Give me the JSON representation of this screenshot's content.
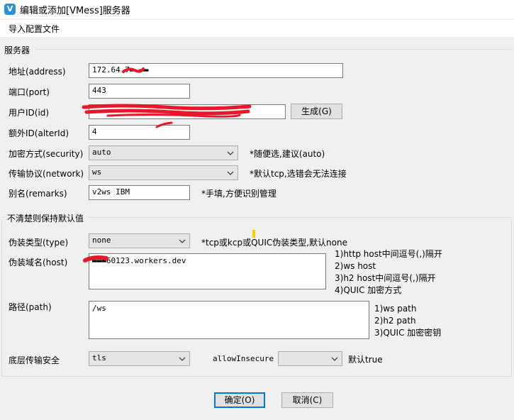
{
  "window": {
    "title": "编辑或添加[VMess]服务器",
    "icon": "v2rayn-app-icon",
    "icon_glyph": "V"
  },
  "menu": {
    "import_config": "导入配置文件"
  },
  "server_section": {
    "heading": "服务器",
    "address": {
      "label": "地址(address)",
      "value": "172.64.7▬.▬▬"
    },
    "port": {
      "label": "端口(port)",
      "value": "443"
    },
    "user_id": {
      "label": "用户ID(id)",
      "value": "",
      "generate_button": "生成(G)"
    },
    "alter_id": {
      "label": "额外ID(alterId)",
      "value": "4"
    },
    "security": {
      "label": "加密方式(security)",
      "selected": "auto",
      "hint": "*随便选,建议(auto)"
    },
    "network": {
      "label": "传输协议(network)",
      "selected": "ws",
      "hint": "*默认tcp,选错会无法连接"
    },
    "remarks": {
      "label": "别名(remarks)",
      "value": "v2ws IBM",
      "hint": "*手填,方便识别管理"
    }
  },
  "advanced_section": {
    "heading": "不清楚则保持默认值",
    "header_type": {
      "label": "伪装类型(type)",
      "selected": "none",
      "hint": "*tcp或kcp或QUIC伪装类型,默认none"
    },
    "host": {
      "label": "伪装域名(host)",
      "value": "▬▬▬60123.workers.dev",
      "hints": [
        "1)http host中间逗号(,)隔开",
        "2)ws host",
        "3)h2 host中间逗号(,)隔开",
        "4)QUIC 加密方式"
      ]
    },
    "path": {
      "label": "路径(path)",
      "value": "/ws",
      "hints": [
        "1)ws path",
        "2)h2 path",
        "3)QUIC 加密密钥"
      ]
    },
    "stream_security": {
      "label": "底层传输安全",
      "selected": "tls"
    },
    "allow_insecure": {
      "label": "allowInsecure",
      "selected": "",
      "hint": "默认true"
    }
  },
  "buttons": {
    "ok": "确定(O)",
    "cancel": "取消(C)"
  },
  "colors": {
    "redaction": "#e8182a",
    "highlight": "#f5d000",
    "focus_border": "#0078d7"
  }
}
